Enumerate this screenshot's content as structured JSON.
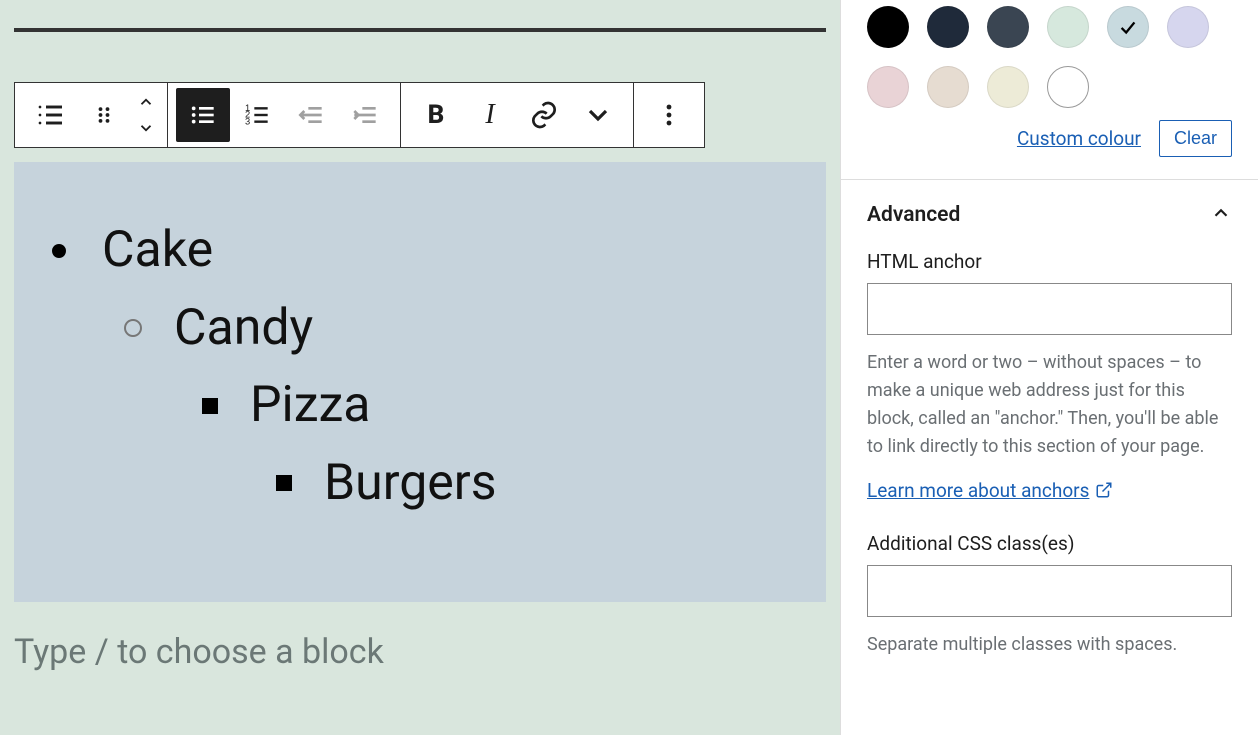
{
  "editor": {
    "list_items": [
      "Cake",
      "Candy",
      "Pizza",
      "Burgers"
    ],
    "placeholder": "Type / to choose a block"
  },
  "toolbar": {
    "list_type_icon": "list-icon",
    "drag_icon": "drag-icon",
    "unordered_icon": "bullet-list-icon",
    "ordered_icon": "numbered-list-icon",
    "outdent_icon": "outdent-icon",
    "indent_icon": "indent-icon",
    "bold": "B",
    "italic": "I",
    "link_icon": "link-icon",
    "more_rich_icon": "chevron-down-icon",
    "options_icon": "more-vertical-icon"
  },
  "sidebar": {
    "colors": [
      {
        "hex": "#000000"
      },
      {
        "hex": "#1f2a3a"
      },
      {
        "hex": "#3a4552"
      },
      {
        "hex": "#d6e8dd"
      },
      {
        "hex": "#c8dadf",
        "selected": true
      },
      {
        "hex": "#d6d6ee"
      },
      {
        "hex": "#e9d3d6"
      },
      {
        "hex": "#e6dcd1"
      },
      {
        "hex": "#edebd7"
      },
      {
        "hex": "#ffffff",
        "white": true
      }
    ],
    "custom_label": "Custom colour",
    "clear_label": "Clear",
    "advanced": {
      "title": "Advanced",
      "anchor_label": "HTML anchor",
      "anchor_value": "",
      "anchor_help": "Enter a word or two – without spaces – to make a unique web address just for this block, called an \"anchor.\" Then, you'll be able to link directly to this section of your page.",
      "anchor_learn": "Learn more about anchors",
      "css_label": "Additional CSS class(es)",
      "css_value": "",
      "css_help": "Separate multiple classes with spaces."
    }
  }
}
